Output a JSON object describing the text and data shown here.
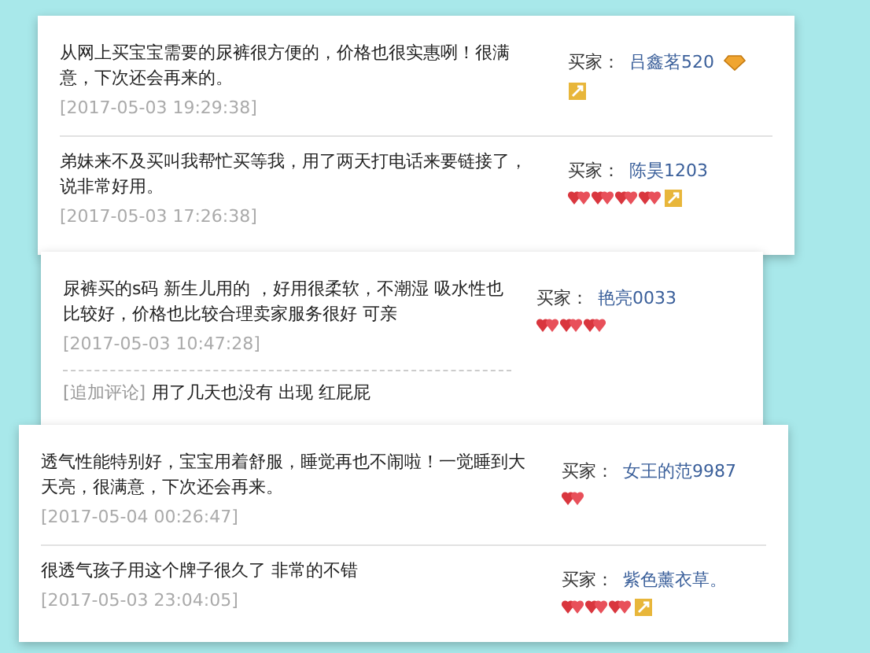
{
  "cards": [
    {
      "reviews": [
        {
          "text": "从网上买宝宝需要的尿裤很方便的，价格也很实惠咧！很满意，下次还会再来的。",
          "date": "[2017-05-03 19:29:38]",
          "buyer_label": "买家：",
          "buyer": "吕鑫茗520",
          "rank_icons": [
            {
              "kind": "diamond"
            }
          ],
          "badge": true
        },
        {
          "text": "弟妹来不及买叫我帮忙买等我，用了两天打电话来要链接了，说非常好用。",
          "date": "[2017-05-03 17:26:38]",
          "buyer_label": "买家：",
          "buyer": "陈昊1203",
          "rank_icons": [
            {
              "kind": "heart"
            },
            {
              "kind": "heart"
            },
            {
              "kind": "heart"
            },
            {
              "kind": "heart"
            }
          ],
          "badge": true
        }
      ]
    },
    {
      "reviews": [
        {
          "text": "尿裤买的s码 新生儿用的 ，好用很柔软，不潮湿 吸水性也比较好，价格也比较合理卖家服务很好 可亲",
          "date": "[2017-05-03 10:47:28]",
          "followup_label": "[追加评论]",
          "followup": "用了几天也没有 出现 红屁屁",
          "buyer_label": "买家：",
          "buyer": "艳亮0033",
          "rank_icons": [
            {
              "kind": "heart"
            },
            {
              "kind": "heart"
            },
            {
              "kind": "heart"
            }
          ]
        }
      ]
    },
    {
      "reviews": [
        {
          "text": "透气性能特别好，宝宝用着舒服，睡觉再也不闹啦！一觉睡到大天亮，很满意，下次还会再来。",
          "date": "[2017-05-04 00:26:47]",
          "buyer_label": "买家：",
          "buyer": "女王的范9987",
          "rank_icons": [
            {
              "kind": "heart"
            }
          ]
        },
        {
          "text": "很透气孩子用这个牌子很久了 非常的不错",
          "date": "[2017-05-03 23:04:05]",
          "buyer_label": "买家：",
          "buyer": "紫色薰衣草。",
          "rank_icons": [
            {
              "kind": "heart"
            },
            {
              "kind": "heart"
            },
            {
              "kind": "heart"
            }
          ],
          "badge": true
        }
      ]
    }
  ]
}
